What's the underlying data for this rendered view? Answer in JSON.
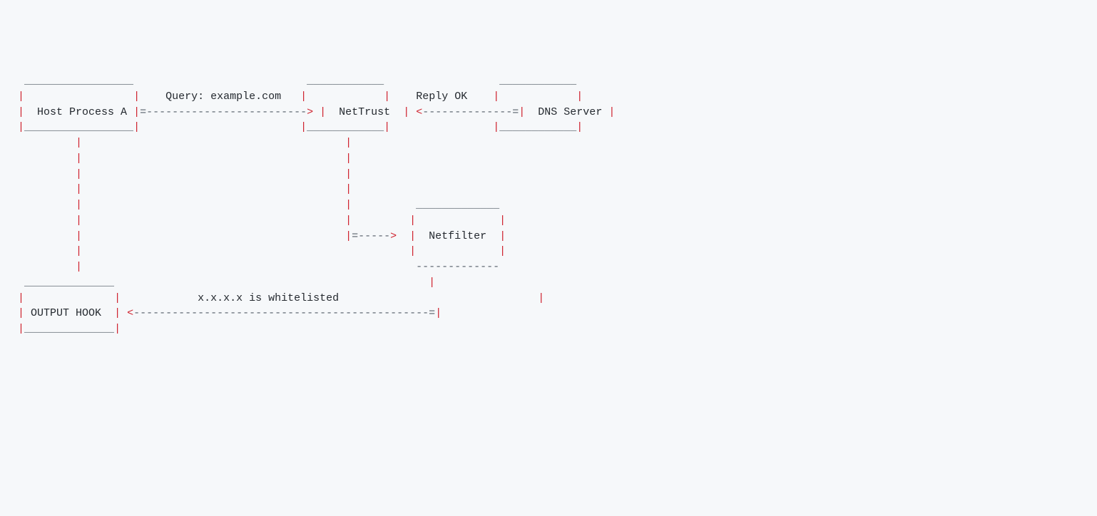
{
  "diagram": {
    "type": "ascii-flow",
    "boxes": {
      "host_process": "  Host Process A ",
      "nettrust": "  NetTrust  ",
      "dns_server": "  DNS Server ",
      "netfilter": "  Netfilter  ",
      "output_hook": " OUTPUT HOOK  "
    },
    "labels": {
      "query": "    Query: example.com   ",
      "reply_ok": "    Reply OK    ",
      "whitelisted": "            x.x.x.x is whitelisted"
    },
    "colors": {
      "pipe": "#cf222e",
      "dash": "#57606a",
      "text": "#24292f"
    }
  },
  "ascii": {
    "line01a": "  _________________                           ____________                  ____________",
    "line02a": " ",
    "line02b": "|",
    "line02c": "                 ",
    "line02d": "|",
    "line02e": "|",
    "line02f": "            ",
    "line02g": "|",
    "line02h": "|",
    "line02i": "            ",
    "line02j": "|",
    "line03a": " ",
    "line03b": "|",
    "line03c": "|",
    "line03d": "=-------------------------",
    "line03e": ">",
    "line03f": " ",
    "line03g": "|",
    "line03h": "|",
    "line03i": " ",
    "line03j": "<",
    "line03k": "--------------=",
    "line03l": "|",
    "line03m": "|",
    "line04a": " ",
    "line04b": "|",
    "line04c": "_________________",
    "line04d": "|",
    "line04e": "                         ",
    "line04f": "|",
    "line04g": "____________",
    "line04h": "|",
    "line04i": "                ",
    "line04j": "|",
    "line04k": "____________",
    "line04l": "|",
    "line05a": "          ",
    "line05b": "|",
    "line05c": "                                         ",
    "line05d": "|",
    "line06a": "          ",
    "line06b": "|",
    "line06c": "                                         ",
    "line06d": "|",
    "line07a": "          ",
    "line07b": "|",
    "line07c": "                                         ",
    "line07d": "|",
    "line08a": "          ",
    "line08b": "|",
    "line08c": "                                         ",
    "line08d": "|",
    "line09a": "          ",
    "line09b": "|",
    "line09c": "                                         ",
    "line09d": "|",
    "line09e": "          _____________",
    "line10a": "          ",
    "line10b": "|",
    "line10c": "                                         ",
    "line10d": "|",
    "line10e": "         ",
    "line10f": "|",
    "line10g": "             ",
    "line10h": "|",
    "line11a": "          ",
    "line11b": "|",
    "line11c": "                                         ",
    "line11d": "|",
    "line11e": "=-----",
    "line11f": ">",
    "line11g": "  ",
    "line11h": "|",
    "line11i": "|",
    "line12a": "          ",
    "line12b": "|",
    "line12c": "                                                   ",
    "line12d": "|",
    "line12e": "             ",
    "line12f": "|",
    "line13a": "          ",
    "line13b": "|",
    "line13c": "                                                    -------------",
    "line14a": "  ______________                                                 ",
    "line14b": "|",
    "line15a": " ",
    "line15b": "|",
    "line15c": "              ",
    "line15d": "|",
    "line15e": "                               ",
    "line15f": "|",
    "line16a": " ",
    "line16b": "|",
    "line16c": "|",
    "line16d": " ",
    "line16e": "<",
    "line16f": "----------------------------------------------=",
    "line16g": "|",
    "line17a": " ",
    "line17b": "|",
    "line17c": "______________",
    "line17d": "|"
  }
}
